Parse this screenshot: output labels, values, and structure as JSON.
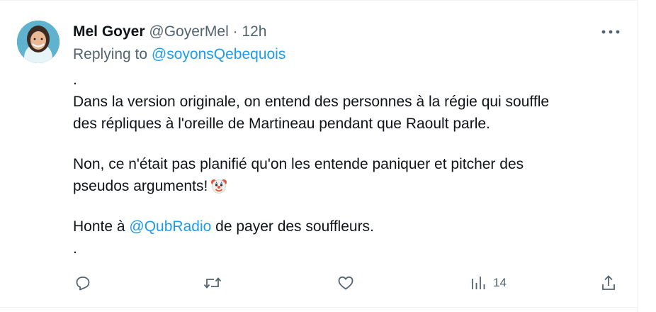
{
  "tweet": {
    "display_name": "Mel Goyer",
    "handle": "@GoyerMel",
    "separator": "·",
    "time": "12h",
    "replying_prefix": "Replying to",
    "replying_to": "@soyonsQebequois",
    "line_dot_top": ".",
    "paragraph1_line1": "Dans la version originale, on entend des personnes à la régie qui souffle",
    "paragraph1_line2": "des répliques à l'oreille de Martineau pendant que Raoult parle.",
    "paragraph2_line1": "Non, ce n'était pas planifié qu'on les entende paniquer et pitcher des",
    "paragraph2_line2": "pseudos arguments!",
    "paragraph3_prefix": "Honte à",
    "paragraph3_mention": "@QubRadio",
    "paragraph3_suffix": "de payer des souffleurs.",
    "line_dot_bottom": ".",
    "emoji": "clown-face",
    "views_count": "14"
  },
  "icons": {
    "more": "more-horizontal-icon",
    "reply": "reply-icon",
    "retweet": "retweet-icon",
    "like": "heart-icon",
    "views": "views-bar-chart-icon",
    "share": "share-icon"
  },
  "colors": {
    "text": "#0f1419",
    "secondary": "#536471",
    "link": "#1d9bf0",
    "border": "#eff3f4"
  }
}
